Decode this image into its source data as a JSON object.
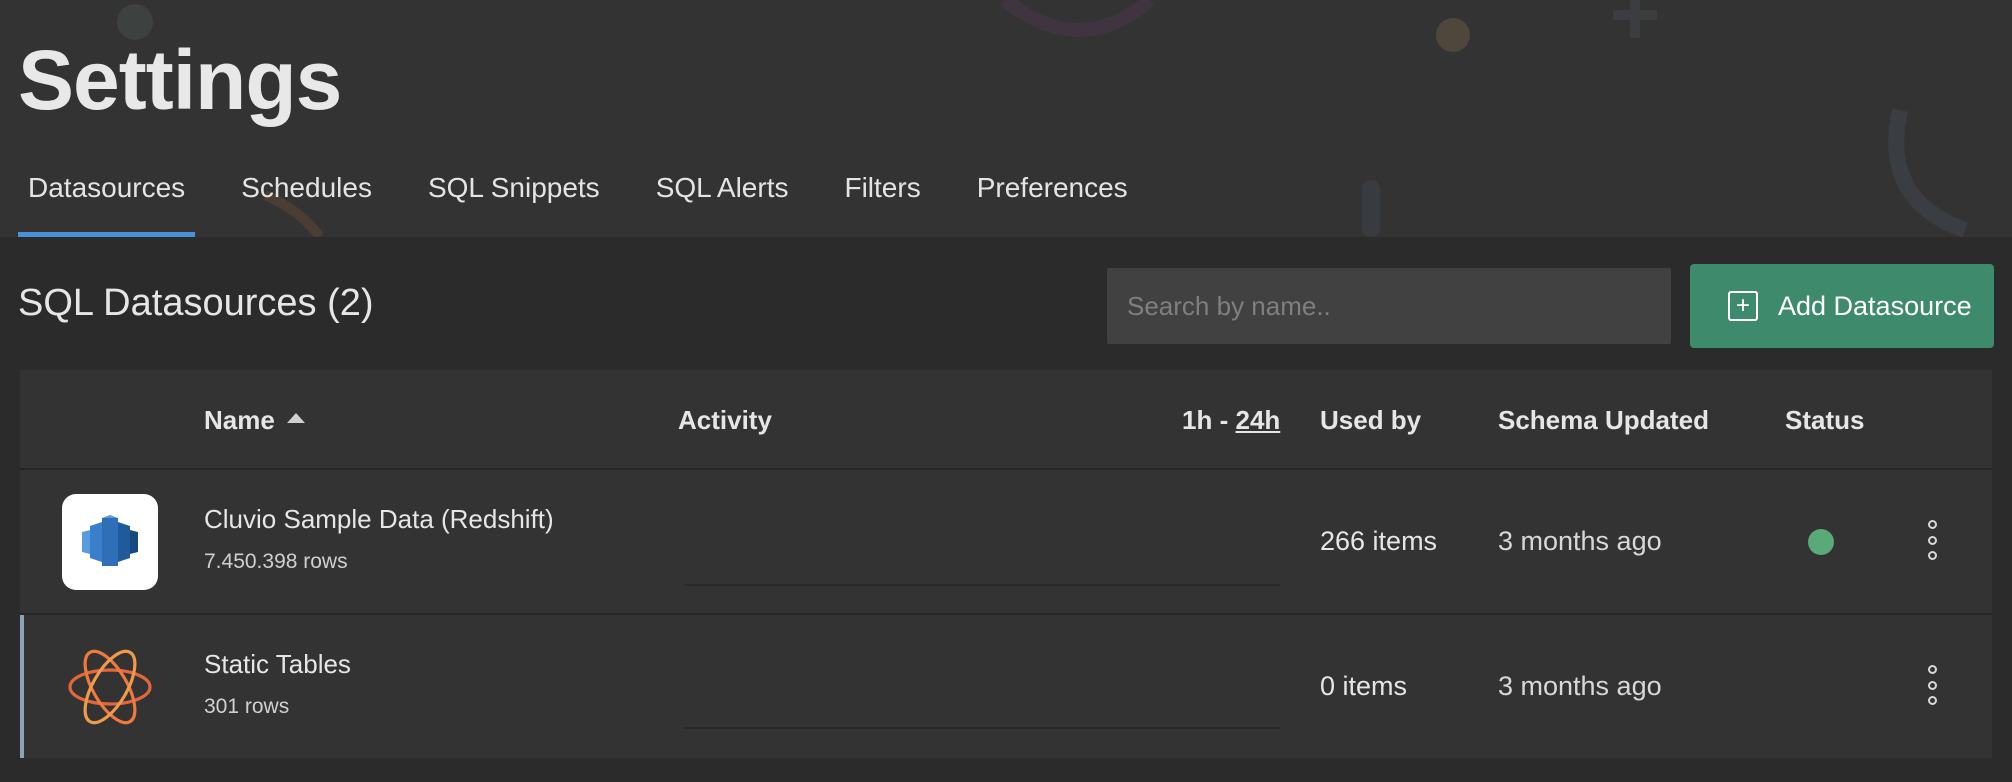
{
  "page": {
    "title": "Settings"
  },
  "tabs": [
    {
      "label": "Datasources",
      "active": true
    },
    {
      "label": "Schedules"
    },
    {
      "label": "SQL Snippets"
    },
    {
      "label": "SQL Alerts"
    },
    {
      "label": "Filters"
    },
    {
      "label": "Preferences"
    }
  ],
  "section": {
    "title": "SQL Datasources (2)"
  },
  "search": {
    "placeholder": "Search by name.."
  },
  "add_button": {
    "label": "Add Datasource",
    "icon": "plus-square-icon"
  },
  "table": {
    "headers": {
      "name": "Name",
      "activity": "Activity",
      "range_short": "1h",
      "range_sep": "-",
      "range_long": "24h",
      "used_by": "Used by",
      "schema_updated": "Schema Updated",
      "status": "Status"
    },
    "sort": {
      "column": "Name",
      "direction": "ascending"
    },
    "rows": [
      {
        "name": "Cluvio Sample Data (Redshift)",
        "rows": "7.450.398 rows",
        "used_by": "266 items",
        "schema_updated": "3 months ago",
        "status": "connected",
        "icon": "redshift-icon"
      },
      {
        "name": "Static Tables",
        "rows": "301 rows",
        "used_by": "0 items",
        "schema_updated": "3 months ago",
        "status": "",
        "icon": "atom-icon"
      }
    ]
  },
  "colors": {
    "accent_tab": "#4a90d9",
    "primary_button": "#3e8a6c",
    "status_ok": "#5aa979"
  }
}
